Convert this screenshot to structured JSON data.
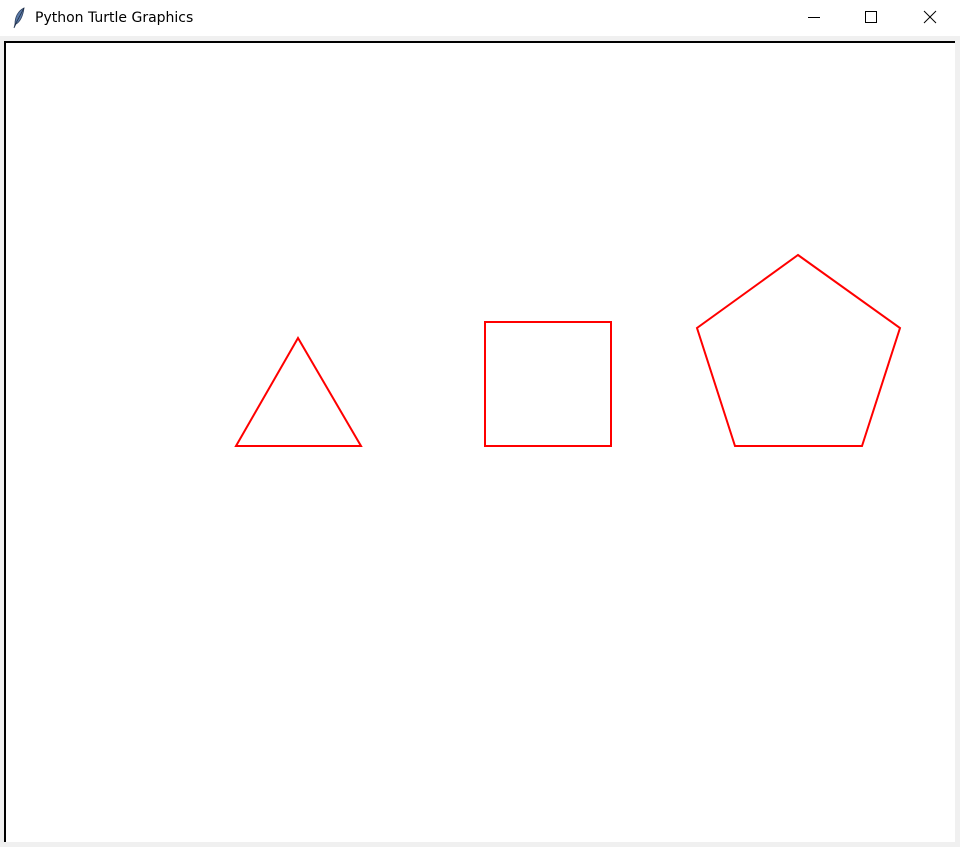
{
  "window": {
    "title": "Python Turtle Graphics",
    "icon": "feather-icon",
    "controls": [
      "minimize-icon",
      "maximize-icon",
      "close-icon"
    ]
  },
  "canvas": {
    "background": "#ffffff",
    "pen_color": "#ff0000",
    "shapes": [
      {
        "name": "triangle",
        "sides": 3
      },
      {
        "name": "square",
        "sides": 4
      },
      {
        "name": "pentagon",
        "sides": 5
      }
    ]
  }
}
